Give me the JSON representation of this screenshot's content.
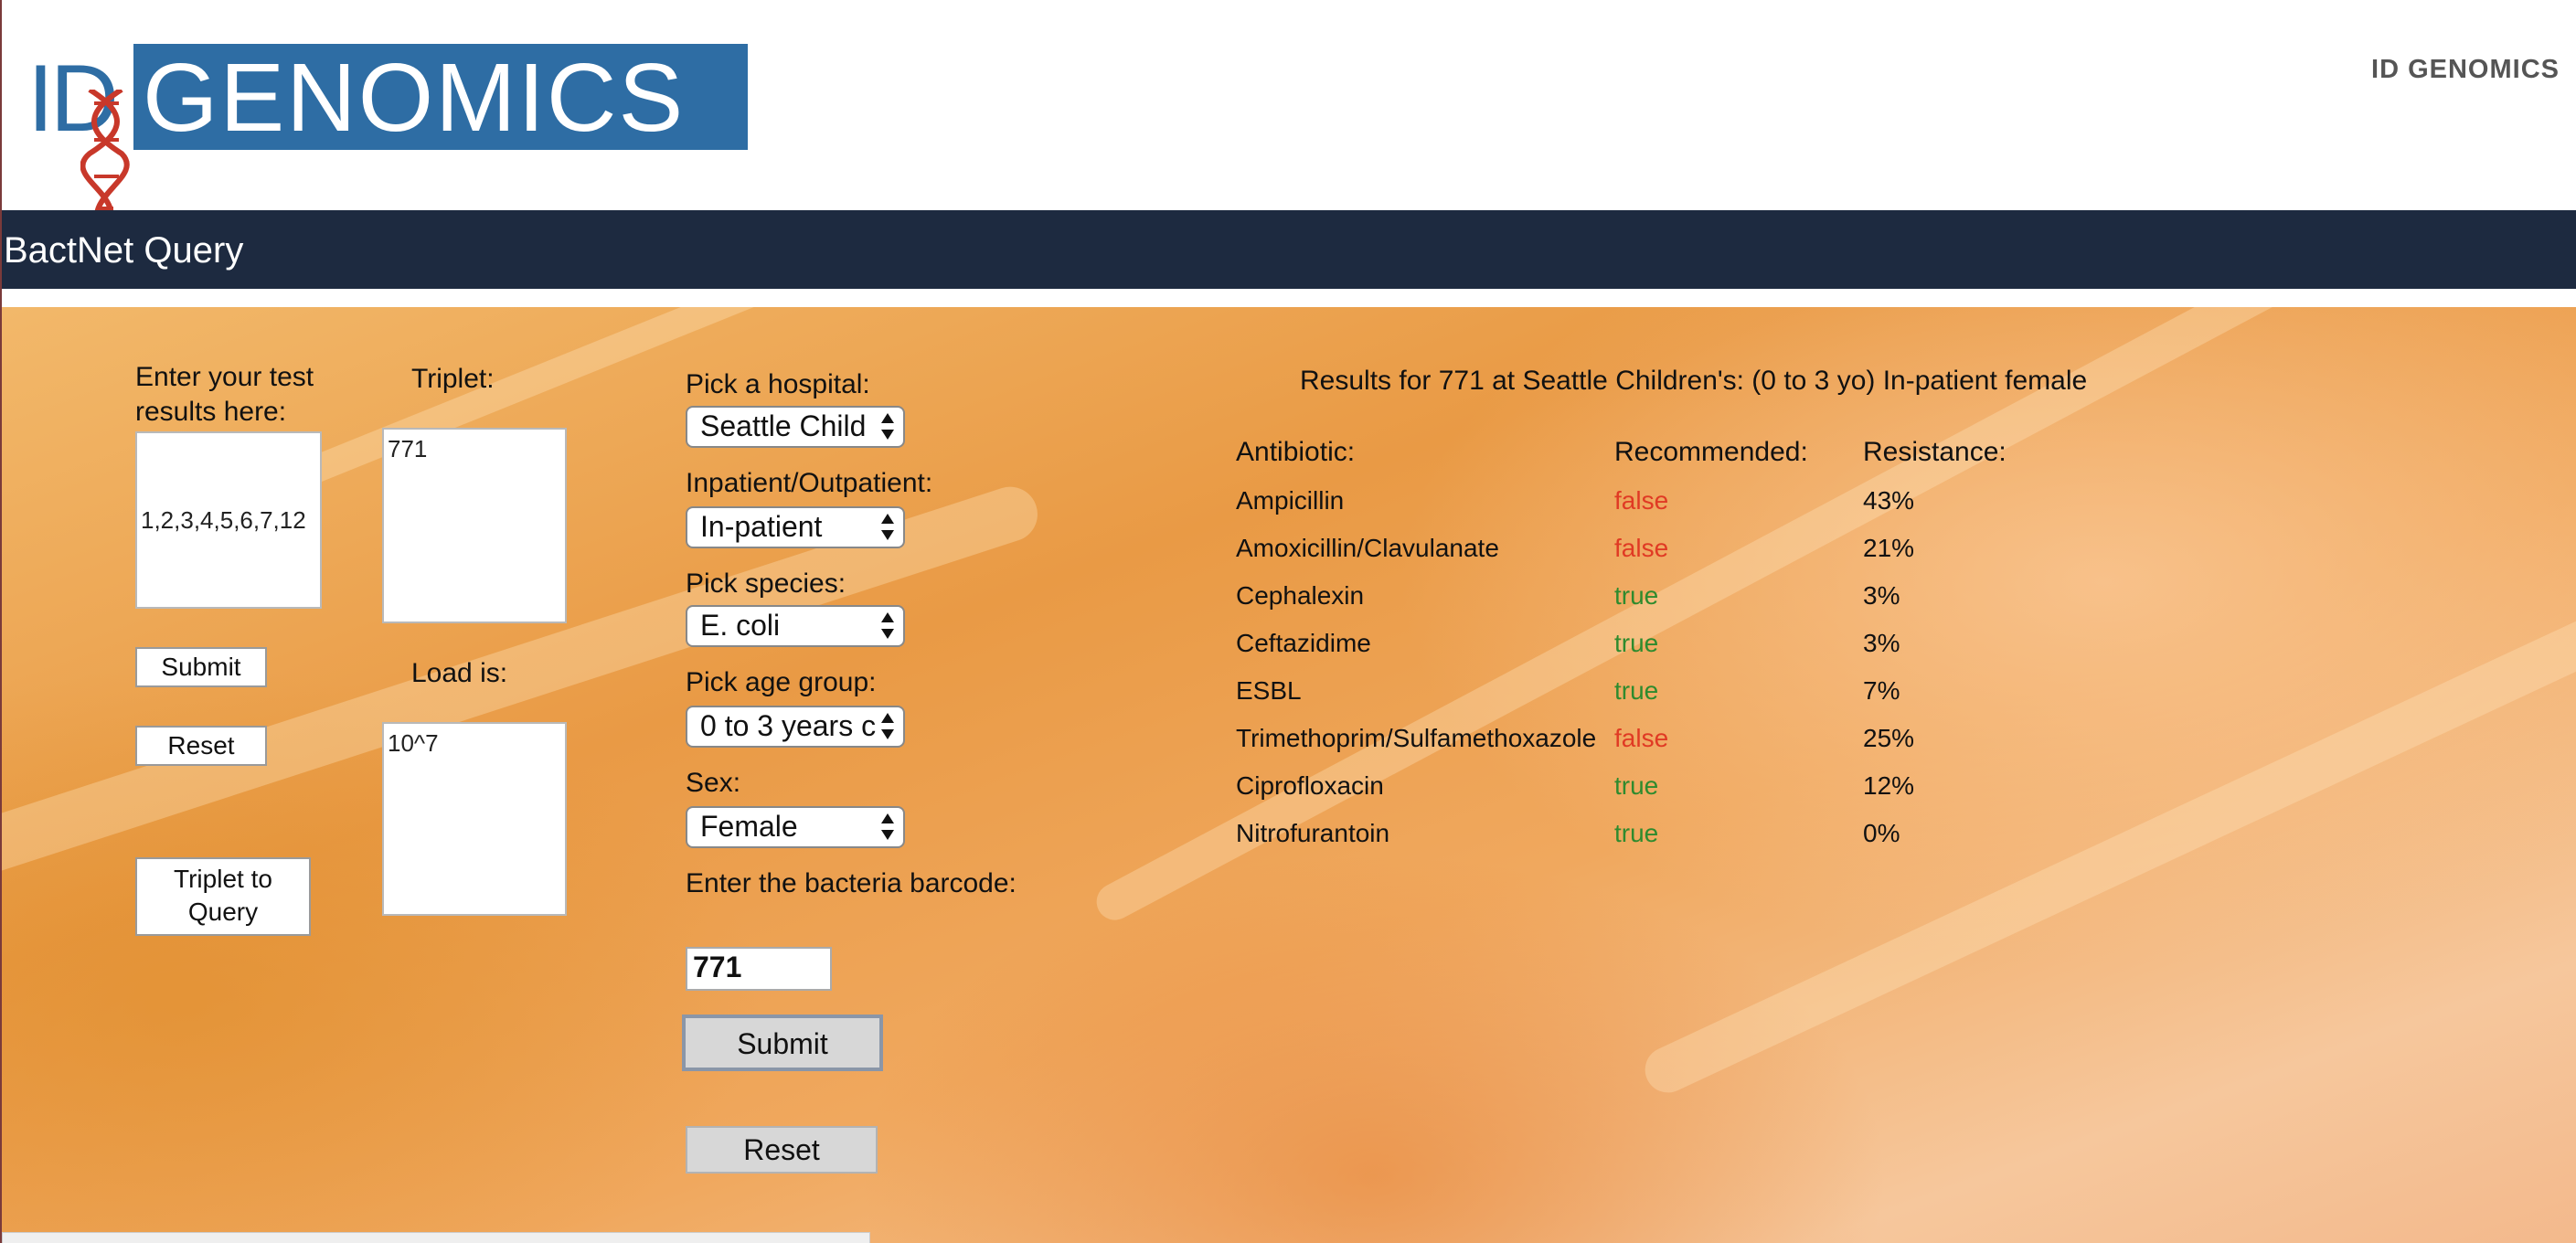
{
  "header": {
    "logo_id": "ID",
    "logo_word": "GENOMICS",
    "brand_right": "ID GENOMICS",
    "page_title": "BactNet Query"
  },
  "left_form": {
    "test_results_label": "Enter your test results here:",
    "test_results_value": "1,2,3,4,5,6,7,12",
    "submit_label": "Submit",
    "reset_label": "Reset",
    "triplet_to_query_label": "Triplet to Query",
    "triplet_label": "Triplet:",
    "triplet_value": "771",
    "load_label": "Load is:",
    "load_value": "10^7"
  },
  "query_form": {
    "hospital_label": "Pick a hospital:",
    "hospital_value": "Seattle Child",
    "inout_label": "Inpatient/Outpatient:",
    "inout_value": "In-patient",
    "species_label": "Pick species:",
    "species_value": "E. coli",
    "age_label": "Pick age group:",
    "age_value": "0 to 3 years c",
    "sex_label": "Sex:",
    "sex_value": "Female",
    "barcode_label": "Enter the bacteria barcode:",
    "barcode_value": "771",
    "submit_label": "Submit",
    "reset_label": "Reset"
  },
  "results": {
    "title": "Results for 771 at Seattle Children's: (0 to 3 yo) In-patient female",
    "headers": [
      "Antibiotic:",
      "Recommended:",
      "Resistance:"
    ],
    "rows": [
      {
        "antibiotic": "Ampicillin",
        "recommended": "false",
        "resistance": "43%"
      },
      {
        "antibiotic": "Amoxicillin/Clavulanate",
        "recommended": "false",
        "resistance": "21%"
      },
      {
        "antibiotic": "Cephalexin",
        "recommended": "true",
        "resistance": "3%"
      },
      {
        "antibiotic": "Ceftazidime",
        "recommended": "true",
        "resistance": "3%"
      },
      {
        "antibiotic": "ESBL",
        "recommended": "true",
        "resistance": "7%"
      },
      {
        "antibiotic": "Trimethoprim/Sulfamethoxazole",
        "recommended": "false",
        "resistance": "25%"
      },
      {
        "antibiotic": "Ciprofloxacin",
        "recommended": "true",
        "resistance": "12%"
      },
      {
        "antibiotic": "Nitrofurantoin",
        "recommended": "true",
        "resistance": "0%"
      }
    ]
  },
  "colors": {
    "brand_blue": "#2e6da4",
    "navbar": "#1d2a40",
    "true_color": "#2e8b2e",
    "false_color": "#e03a24"
  }
}
